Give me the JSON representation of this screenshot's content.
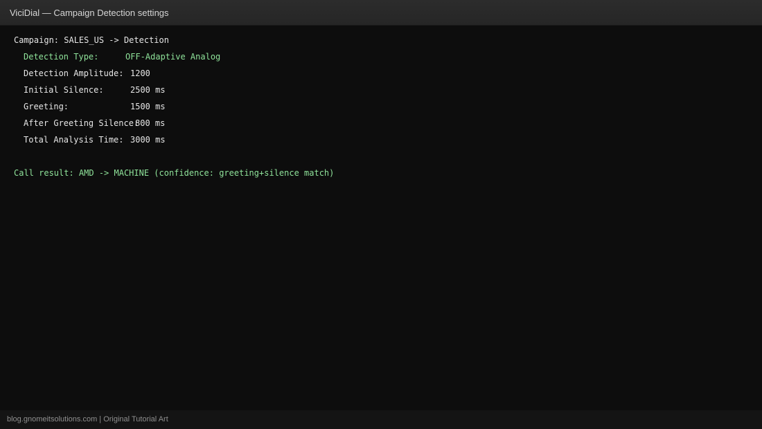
{
  "window": {
    "title": "ViciDial — Campaign Detection settings"
  },
  "terminal": {
    "header": "Campaign: SALES_US -> Detection",
    "settings": [
      {
        "label": "Detection Type:",
        "value": "OFF-Adaptive Analog",
        "highlight": true
      },
      {
        "label": "Detection Amplitude:",
        "value": "1200",
        "highlight": false
      },
      {
        "label": "Initial Silence:",
        "value": "2500 ms",
        "highlight": false
      },
      {
        "label": "Greeting:",
        "value": "1500 ms",
        "highlight": false
      },
      {
        "label": "After Greeting Silence:",
        "value": "800 ms",
        "highlight": false
      },
      {
        "label": "Total Analysis Time:",
        "value": "3000 ms",
        "highlight": false
      }
    ],
    "result": "Call result: AMD -> MACHINE (confidence: greeting+silence match)"
  },
  "footer": {
    "text": "blog.gnomeitsolutions.com | Original Tutorial Art"
  },
  "colors": {
    "background": "#0d0d0d",
    "text": "#e6e6e6",
    "accent_green": "#8fe39a",
    "titlebar": "#2a2a2a"
  }
}
